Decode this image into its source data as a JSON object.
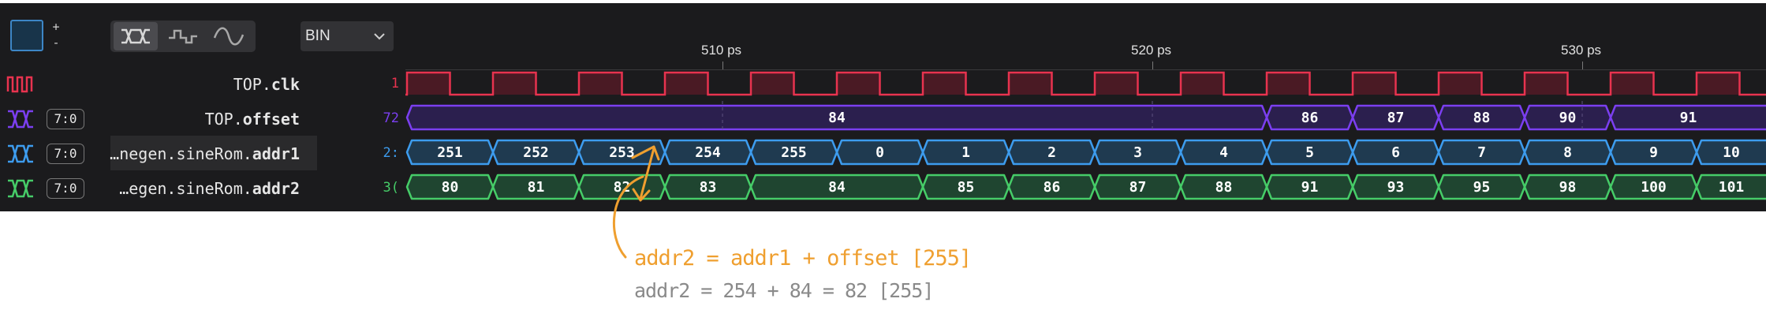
{
  "toolbar": {
    "step_up": "+",
    "step_down": "-",
    "radix": "BIN",
    "render_modes": [
      "bus",
      "digital",
      "analog"
    ]
  },
  "colors": {
    "clk": "#e8334f",
    "offset": "#7b3ff0",
    "addr1": "#3d9cee",
    "addr2": "#46cc68",
    "annotation": "#ef9f2f",
    "annotation_note": "#8a8a8a"
  },
  "timescale": {
    "labels": [
      "510 ps",
      "520 ps",
      "530 ps"
    ]
  },
  "signals": [
    {
      "icon": "clock-wave-icon",
      "width": "",
      "name_prefix": "TOP.",
      "name_tail": "clk",
      "value": "1",
      "color": "#e8334f"
    },
    {
      "icon": "bus-wave-icon",
      "width": "7:0",
      "name_prefix": "TOP.",
      "name_tail": "offset",
      "value": "72",
      "color": "#7b3ff0"
    },
    {
      "icon": "bus-wave-icon",
      "width": "7:0",
      "name_prefix": "…negen.sineRom.",
      "name_tail": "addr1",
      "value": "2:",
      "color": "#3d9cee"
    },
    {
      "icon": "bus-wave-icon",
      "width": "7:0",
      "name_prefix": "…egen.sineRom.",
      "name_tail": "addr2",
      "value": "3(",
      "color": "#46cc68"
    }
  ],
  "waves": {
    "offset": [
      "84",
      "86",
      "87",
      "88",
      "90",
      "91"
    ],
    "addr1": [
      "251",
      "252",
      "253",
      "254",
      "255",
      "0",
      "1",
      "2",
      "3",
      "4",
      "5",
      "6",
      "7",
      "8",
      "9",
      "10"
    ],
    "addr2": [
      "80",
      "81",
      "82",
      "83",
      "84",
      "85",
      "86",
      "87",
      "88",
      "91",
      "93",
      "95",
      "98",
      "100",
      "101"
    ]
  },
  "annotations": {
    "formula": "addr2 = addr1 + offset [255]",
    "example": "addr2 = 254 + 84 = 82 [255]"
  }
}
